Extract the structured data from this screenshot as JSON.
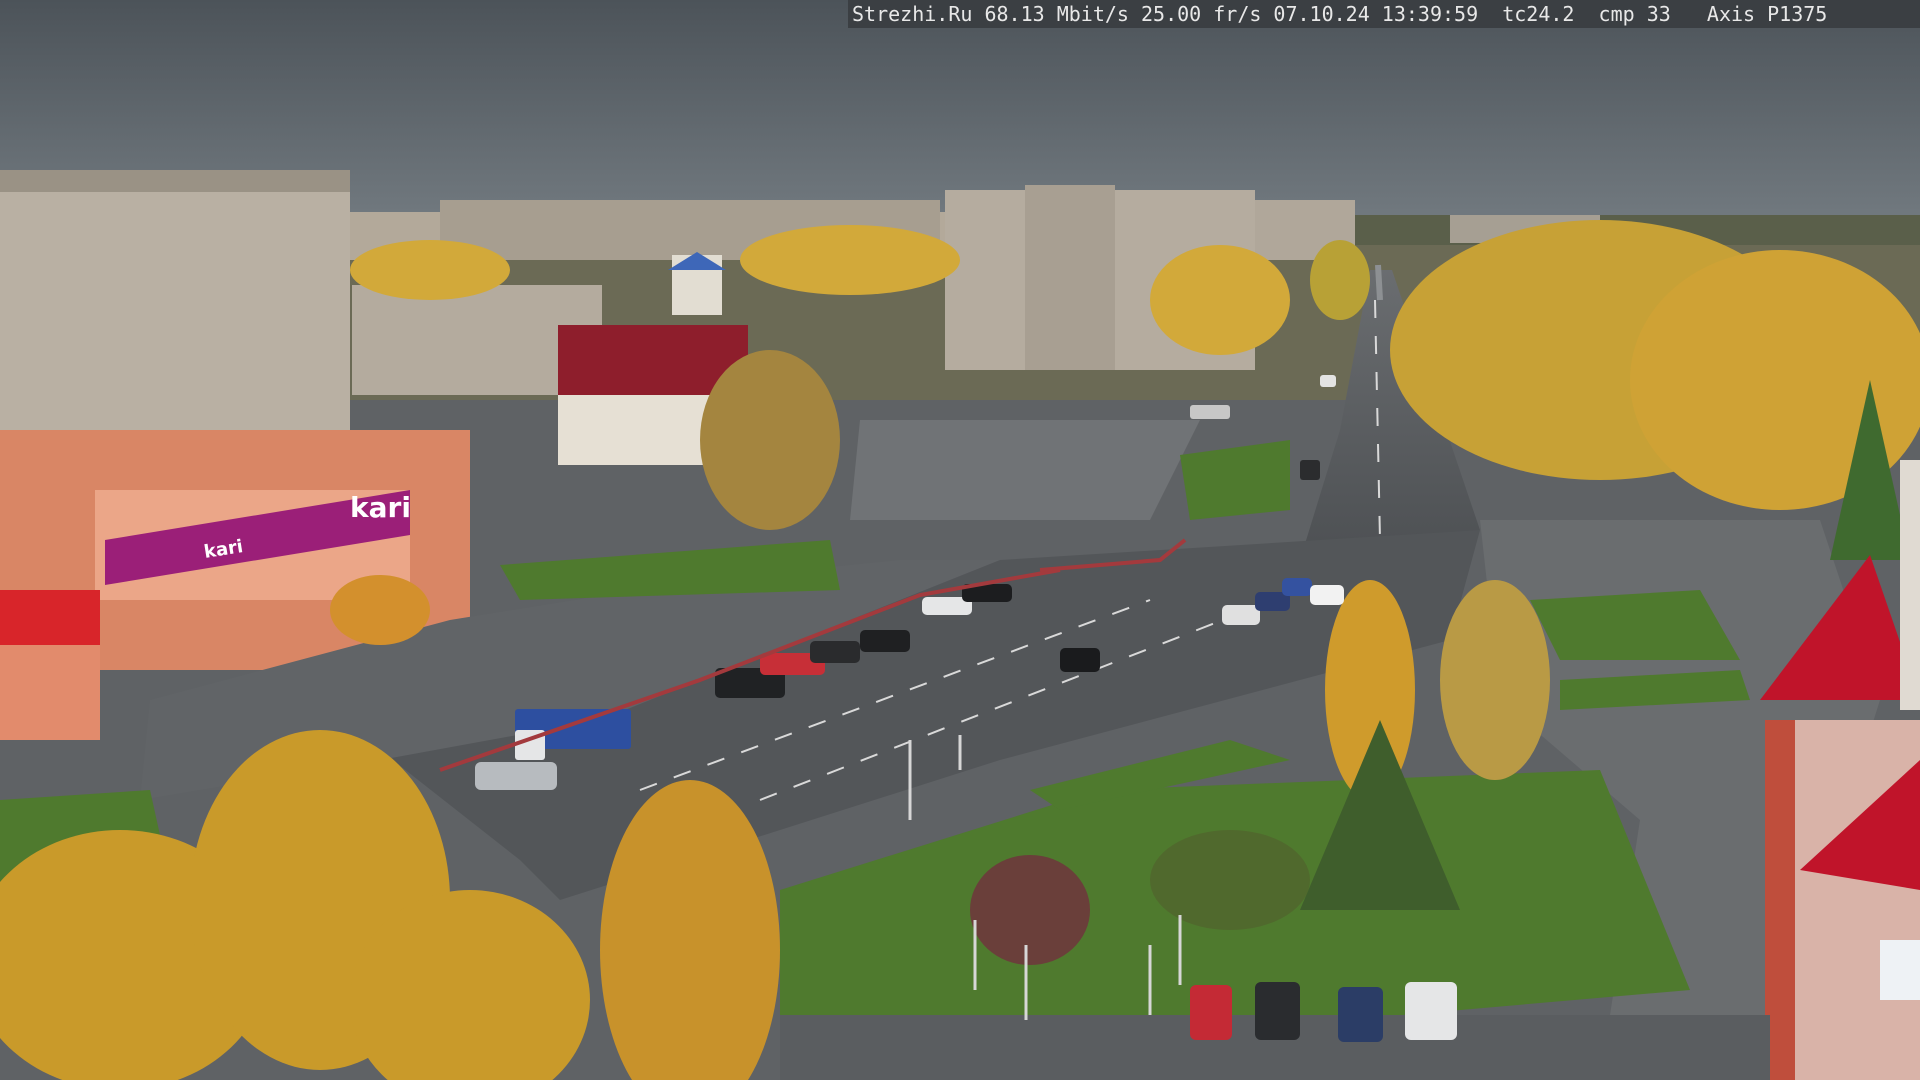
{
  "osd": {
    "text": "Strezhi.Ru 68.13 Mbit/s 25.00 fr/s 07.10.24 13:39:59  tc24.2  cmp 33   Axis P1375"
  },
  "signage": {
    "store_sign": "kari",
    "store_sign_side": "kari"
  },
  "colors": {
    "sky": "#5c646b",
    "autumn_foliage": "#c99a2a",
    "asphalt": "#5a5d60",
    "grass": "#4f7a2e",
    "brand_magenta": "#9b1f78",
    "roof_red": "#c0142a"
  }
}
